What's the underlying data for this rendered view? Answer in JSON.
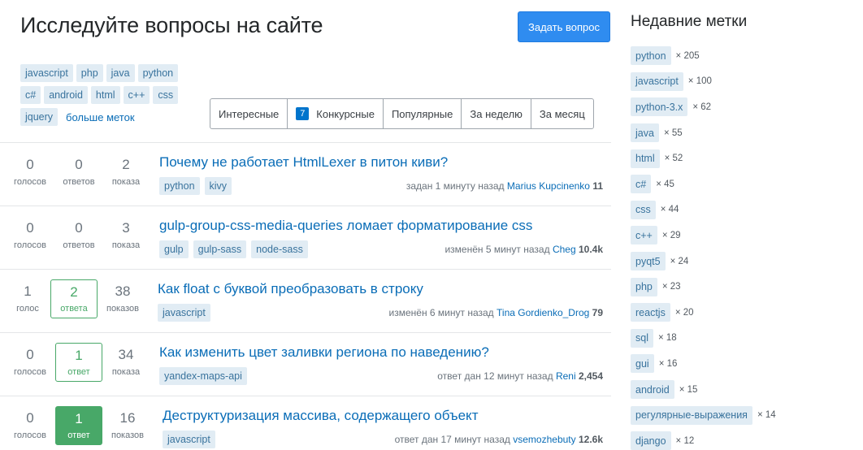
{
  "header": {
    "title": "Исследуйте вопросы на сайте",
    "ask_button": "Задать вопрос"
  },
  "tag_cloud": {
    "rows": [
      [
        "javascript",
        "php",
        "java",
        "python"
      ],
      [
        "c#",
        "android",
        "html",
        "c++",
        "css"
      ],
      [
        "jquery"
      ]
    ],
    "more_label": "больше меток"
  },
  "filters": {
    "interesting": "Интересные",
    "bounty_count": "7",
    "bounty": "Конкурсные",
    "popular": "Популярные",
    "week": "За неделю",
    "month": "За месяц"
  },
  "questions": [
    {
      "votes": "0",
      "votes_label": "голосов",
      "answers": "0",
      "answers_label": "ответов",
      "views": "2",
      "views_label": "показа",
      "title": "Почему не работает HtmlLexer в питон киви?",
      "tags": [
        "python",
        "kivy"
      ],
      "action": "задан 1 минуту назад",
      "user": "Marius Kupcinenko",
      "rep": "11"
    },
    {
      "votes": "0",
      "votes_label": "голосов",
      "answers": "0",
      "answers_label": "ответов",
      "views": "3",
      "views_label": "показа",
      "title": "gulp-group-css-media-queries ломает форматирование css",
      "tags": [
        "gulp",
        "gulp-sass",
        "node-sass"
      ],
      "action": "изменён 5 минут назад",
      "user": "Cheg",
      "rep": "10.4k"
    },
    {
      "votes": "1",
      "votes_label": "голос",
      "answers": "2",
      "answers_label": "ответа",
      "views": "38",
      "views_label": "показов",
      "title": "Как float с буквой преобразовать в строку",
      "tags": [
        "javascript"
      ],
      "action": "изменён 6 минут назад",
      "user": "Tina Gordienko_Drog",
      "rep": "79"
    },
    {
      "votes": "0",
      "votes_label": "голосов",
      "answers": "1",
      "answers_label": "ответ",
      "views": "34",
      "views_label": "показа",
      "title": "Как изменить цвет заливки региона по наведению?",
      "tags": [
        "yandex-maps-api"
      ],
      "action": "ответ дан 12 минут назад",
      "user": "Reni",
      "rep": "2,454"
    },
    {
      "votes": "0",
      "votes_label": "голосов",
      "answers": "1",
      "answers_label": "ответ",
      "views": "16",
      "views_label": "показов",
      "title": "Деструктуризация массива, содержащего объект",
      "tags": [
        "javascript"
      ],
      "action": "ответ дан 17 минут назад",
      "user": "vsemozhebuty",
      "rep": "12.6k"
    }
  ],
  "sidebar": {
    "title": "Недавние метки",
    "tags": [
      {
        "name": "python",
        "count": "× 205"
      },
      {
        "name": "javascript",
        "count": "× 100"
      },
      {
        "name": "python-3.x",
        "count": "× 62"
      },
      {
        "name": "java",
        "count": "× 55"
      },
      {
        "name": "html",
        "count": "× 52"
      },
      {
        "name": "c#",
        "count": "× 45"
      },
      {
        "name": "css",
        "count": "× 44"
      },
      {
        "name": "c++",
        "count": "× 29"
      },
      {
        "name": "pyqt5",
        "count": "× 24"
      },
      {
        "name": "php",
        "count": "× 23"
      },
      {
        "name": "reactjs",
        "count": "× 20"
      },
      {
        "name": "sql",
        "count": "× 18"
      },
      {
        "name": "gui",
        "count": "× 16"
      },
      {
        "name": "android",
        "count": "× 15"
      },
      {
        "name": "регулярные-выражения",
        "count": "× 14"
      },
      {
        "name": "django",
        "count": "× 12"
      }
    ]
  }
}
